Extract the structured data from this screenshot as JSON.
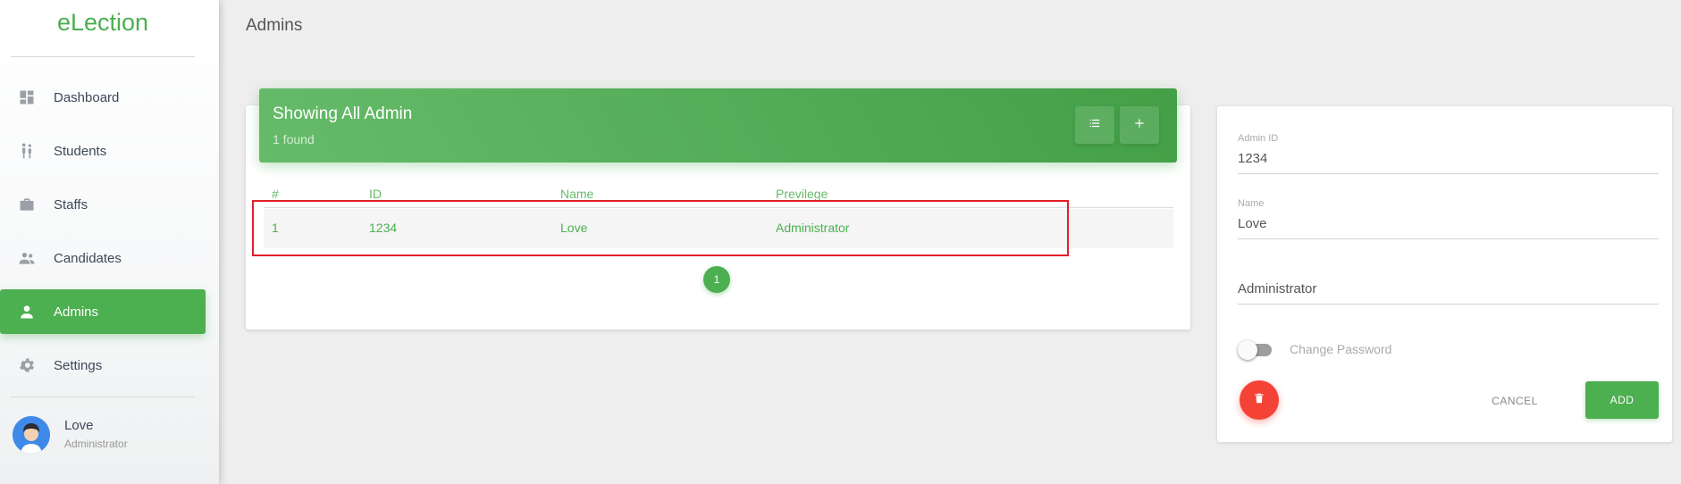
{
  "sidebar": {
    "brand": "eLection",
    "items": [
      {
        "label": "Dashboard",
        "icon": "dashboard-icon"
      },
      {
        "label": "Students",
        "icon": "students-icon"
      },
      {
        "label": "Staffs",
        "icon": "briefcase-icon"
      },
      {
        "label": "Candidates",
        "icon": "people-icon"
      },
      {
        "label": "Admins",
        "icon": "person-icon",
        "active": true
      },
      {
        "label": "Settings",
        "icon": "gear-icon"
      }
    ],
    "user": {
      "name": "Love",
      "role": "Administrator"
    }
  },
  "page": {
    "title": "Admins"
  },
  "card": {
    "title": "Showing All Admin",
    "subtitle": "1 found",
    "list_icon": "list-icon",
    "add_icon": "plus-icon"
  },
  "table": {
    "headers": [
      "#",
      "ID",
      "Name",
      "Previlege"
    ],
    "rows": [
      {
        "num": "1",
        "id": "1234",
        "name": "Love",
        "privilege": "Administrator"
      }
    ]
  },
  "pagination": {
    "current": "1"
  },
  "form": {
    "admin_id": {
      "label": "Admin ID",
      "value": "1234"
    },
    "name": {
      "label": "Name",
      "value": "Love"
    },
    "privilege": {
      "value": "Administrator"
    },
    "change_password": {
      "label": "Change Password",
      "on": false
    },
    "cancel_label": "CANCEL",
    "add_label": "ADD",
    "delete_icon": "trash-icon"
  },
  "colors": {
    "accent": "#4caf50",
    "danger": "#f44336",
    "highlight": "#e0202a"
  }
}
